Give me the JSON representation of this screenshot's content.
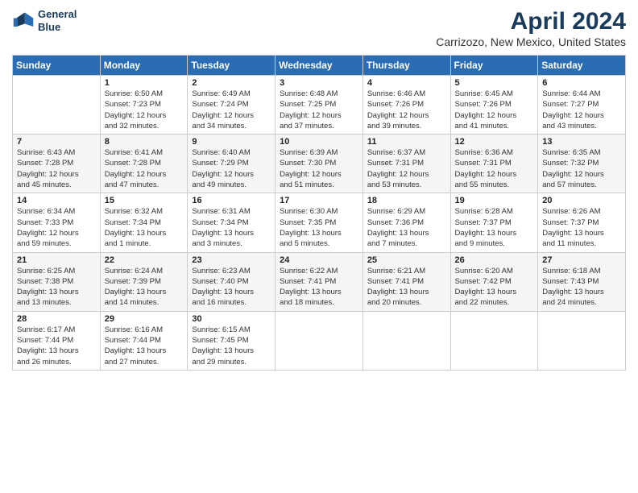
{
  "header": {
    "logo_line1": "General",
    "logo_line2": "Blue",
    "title": "April 2024",
    "subtitle": "Carrizozo, New Mexico, United States"
  },
  "weekdays": [
    "Sunday",
    "Monday",
    "Tuesday",
    "Wednesday",
    "Thursday",
    "Friday",
    "Saturday"
  ],
  "weeks": [
    [
      {
        "num": "",
        "info": ""
      },
      {
        "num": "1",
        "info": "Sunrise: 6:50 AM\nSunset: 7:23 PM\nDaylight: 12 hours\nand 32 minutes."
      },
      {
        "num": "2",
        "info": "Sunrise: 6:49 AM\nSunset: 7:24 PM\nDaylight: 12 hours\nand 34 minutes."
      },
      {
        "num": "3",
        "info": "Sunrise: 6:48 AM\nSunset: 7:25 PM\nDaylight: 12 hours\nand 37 minutes."
      },
      {
        "num": "4",
        "info": "Sunrise: 6:46 AM\nSunset: 7:26 PM\nDaylight: 12 hours\nand 39 minutes."
      },
      {
        "num": "5",
        "info": "Sunrise: 6:45 AM\nSunset: 7:26 PM\nDaylight: 12 hours\nand 41 minutes."
      },
      {
        "num": "6",
        "info": "Sunrise: 6:44 AM\nSunset: 7:27 PM\nDaylight: 12 hours\nand 43 minutes."
      }
    ],
    [
      {
        "num": "7",
        "info": "Sunrise: 6:43 AM\nSunset: 7:28 PM\nDaylight: 12 hours\nand 45 minutes."
      },
      {
        "num": "8",
        "info": "Sunrise: 6:41 AM\nSunset: 7:28 PM\nDaylight: 12 hours\nand 47 minutes."
      },
      {
        "num": "9",
        "info": "Sunrise: 6:40 AM\nSunset: 7:29 PM\nDaylight: 12 hours\nand 49 minutes."
      },
      {
        "num": "10",
        "info": "Sunrise: 6:39 AM\nSunset: 7:30 PM\nDaylight: 12 hours\nand 51 minutes."
      },
      {
        "num": "11",
        "info": "Sunrise: 6:37 AM\nSunset: 7:31 PM\nDaylight: 12 hours\nand 53 minutes."
      },
      {
        "num": "12",
        "info": "Sunrise: 6:36 AM\nSunset: 7:31 PM\nDaylight: 12 hours\nand 55 minutes."
      },
      {
        "num": "13",
        "info": "Sunrise: 6:35 AM\nSunset: 7:32 PM\nDaylight: 12 hours\nand 57 minutes."
      }
    ],
    [
      {
        "num": "14",
        "info": "Sunrise: 6:34 AM\nSunset: 7:33 PM\nDaylight: 12 hours\nand 59 minutes."
      },
      {
        "num": "15",
        "info": "Sunrise: 6:32 AM\nSunset: 7:34 PM\nDaylight: 13 hours\nand 1 minute."
      },
      {
        "num": "16",
        "info": "Sunrise: 6:31 AM\nSunset: 7:34 PM\nDaylight: 13 hours\nand 3 minutes."
      },
      {
        "num": "17",
        "info": "Sunrise: 6:30 AM\nSunset: 7:35 PM\nDaylight: 13 hours\nand 5 minutes."
      },
      {
        "num": "18",
        "info": "Sunrise: 6:29 AM\nSunset: 7:36 PM\nDaylight: 13 hours\nand 7 minutes."
      },
      {
        "num": "19",
        "info": "Sunrise: 6:28 AM\nSunset: 7:37 PM\nDaylight: 13 hours\nand 9 minutes."
      },
      {
        "num": "20",
        "info": "Sunrise: 6:26 AM\nSunset: 7:37 PM\nDaylight: 13 hours\nand 11 minutes."
      }
    ],
    [
      {
        "num": "21",
        "info": "Sunrise: 6:25 AM\nSunset: 7:38 PM\nDaylight: 13 hours\nand 13 minutes."
      },
      {
        "num": "22",
        "info": "Sunrise: 6:24 AM\nSunset: 7:39 PM\nDaylight: 13 hours\nand 14 minutes."
      },
      {
        "num": "23",
        "info": "Sunrise: 6:23 AM\nSunset: 7:40 PM\nDaylight: 13 hours\nand 16 minutes."
      },
      {
        "num": "24",
        "info": "Sunrise: 6:22 AM\nSunset: 7:41 PM\nDaylight: 13 hours\nand 18 minutes."
      },
      {
        "num": "25",
        "info": "Sunrise: 6:21 AM\nSunset: 7:41 PM\nDaylight: 13 hours\nand 20 minutes."
      },
      {
        "num": "26",
        "info": "Sunrise: 6:20 AM\nSunset: 7:42 PM\nDaylight: 13 hours\nand 22 minutes."
      },
      {
        "num": "27",
        "info": "Sunrise: 6:18 AM\nSunset: 7:43 PM\nDaylight: 13 hours\nand 24 minutes."
      }
    ],
    [
      {
        "num": "28",
        "info": "Sunrise: 6:17 AM\nSunset: 7:44 PM\nDaylight: 13 hours\nand 26 minutes."
      },
      {
        "num": "29",
        "info": "Sunrise: 6:16 AM\nSunset: 7:44 PM\nDaylight: 13 hours\nand 27 minutes."
      },
      {
        "num": "30",
        "info": "Sunrise: 6:15 AM\nSunset: 7:45 PM\nDaylight: 13 hours\nand 29 minutes."
      },
      {
        "num": "",
        "info": ""
      },
      {
        "num": "",
        "info": ""
      },
      {
        "num": "",
        "info": ""
      },
      {
        "num": "",
        "info": ""
      }
    ]
  ]
}
